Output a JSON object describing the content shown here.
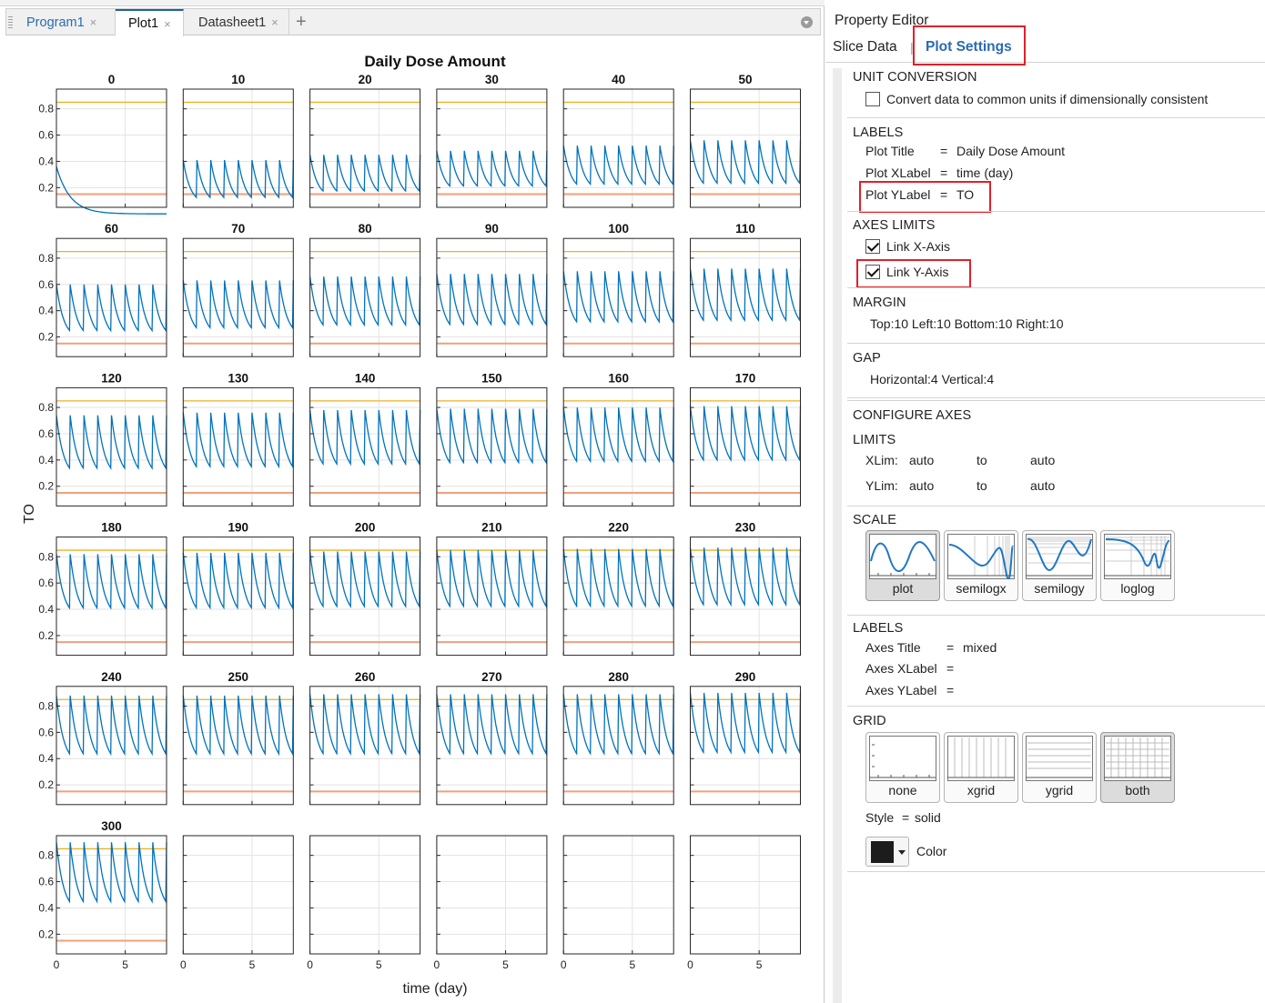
{
  "tabs": [
    {
      "label": "Program1",
      "close": "×"
    },
    {
      "label": "Plot1",
      "close": "×"
    },
    {
      "label": "Datasheet1",
      "close": "×"
    }
  ],
  "tab_add": "+",
  "chart_data": {
    "type": "line",
    "title": "Daily Dose Amount",
    "xlabel": "time (day)",
    "ylabel": "TO",
    "xlim": [
      0,
      8
    ],
    "ylim": [
      0.05,
      0.95
    ],
    "yticks": [
      0.2,
      0.4,
      0.6,
      0.8
    ],
    "xticks": [
      0,
      5
    ],
    "grid": "both",
    "upper_line_y": 0.85,
    "lower_line_y": 0.15,
    "colors": {
      "series": "#0072bd",
      "upper": "#edb120",
      "lower": "#f0a07a"
    },
    "panels": [
      {
        "title": "0",
        "peak": 0.36,
        "trough": 0.0
      },
      {
        "title": "10",
        "peak": 0.41,
        "trough": 0.07
      },
      {
        "title": "20",
        "peak": 0.45,
        "trough": 0.12
      },
      {
        "title": "30",
        "peak": 0.48,
        "trough": 0.16
      },
      {
        "title": "40",
        "peak": 0.52,
        "trough": 0.17
      },
      {
        "title": "50",
        "peak": 0.56,
        "trough": 0.17
      },
      {
        "title": "60",
        "peak": 0.6,
        "trough": 0.18
      },
      {
        "title": "70",
        "peak": 0.63,
        "trough": 0.2
      },
      {
        "title": "80",
        "peak": 0.66,
        "trough": 0.22
      },
      {
        "title": "90",
        "peak": 0.68,
        "trough": 0.22
      },
      {
        "title": "100",
        "peak": 0.7,
        "trough": 0.24
      },
      {
        "title": "110",
        "peak": 0.72,
        "trough": 0.25
      },
      {
        "title": "120",
        "peak": 0.74,
        "trough": 0.26
      },
      {
        "title": "130",
        "peak": 0.76,
        "trough": 0.27
      },
      {
        "title": "140",
        "peak": 0.78,
        "trough": 0.29
      },
      {
        "title": "150",
        "peak": 0.79,
        "trough": 0.3
      },
      {
        "title": "160",
        "peak": 0.8,
        "trough": 0.31
      },
      {
        "title": "170",
        "peak": 0.81,
        "trough": 0.32
      },
      {
        "title": "180",
        "peak": 0.82,
        "trough": 0.33
      },
      {
        "title": "190",
        "peak": 0.83,
        "trough": 0.33
      },
      {
        "title": "200",
        "peak": 0.84,
        "trough": 0.34
      },
      {
        "title": "210",
        "peak": 0.85,
        "trough": 0.34
      },
      {
        "title": "220",
        "peak": 0.86,
        "trough": 0.34
      },
      {
        "title": "230",
        "peak": 0.87,
        "trough": 0.35
      },
      {
        "title": "240",
        "peak": 0.88,
        "trough": 0.35
      },
      {
        "title": "250",
        "peak": 0.88,
        "trough": 0.35
      },
      {
        "title": "260",
        "peak": 0.89,
        "trough": 0.35
      },
      {
        "title": "270",
        "peak": 0.89,
        "trough": 0.35
      },
      {
        "title": "280",
        "peak": 0.89,
        "trough": 0.35
      },
      {
        "title": "290",
        "peak": 0.9,
        "trough": 0.36
      },
      {
        "title": "300",
        "peak": 0.9,
        "trough": 0.36
      }
    ],
    "empty_panels": 5
  },
  "property_editor": {
    "title": "Property Editor",
    "tab_slice": "Slice Data",
    "tab_separator": "|",
    "tab_plot_settings": "Plot Settings",
    "unit_conversion": {
      "heading": "UNIT CONVERSION",
      "checkbox_label": "Convert data to common units if dimensionally consistent",
      "checked": false
    },
    "labels": {
      "heading": "LABELS",
      "plot_title_key": "Plot Title",
      "plot_title_eq": "=",
      "plot_title_value": "Daily Dose Amount",
      "plot_xlabel_key": "Plot XLabel",
      "plot_xlabel_eq": "=",
      "plot_xlabel_value": "time (day)",
      "plot_ylabel_key": "Plot YLabel",
      "plot_ylabel_eq": "=",
      "plot_ylabel_value": "TO"
    },
    "axes_limits": {
      "heading": "AXES LIMITS",
      "link_x": "Link X-Axis",
      "link_y": "Link Y-Axis",
      "link_x_checked": true,
      "link_y_checked": true
    },
    "margin": {
      "heading": "MARGIN",
      "value": "Top:10 Left:10 Bottom:10 Right:10"
    },
    "gap": {
      "heading": "GAP",
      "value": "Horizontal:4 Vertical:4"
    },
    "configure_axes": {
      "heading": "CONFIGURE AXES"
    },
    "limits": {
      "heading": "LIMITS",
      "xlim_key": "XLim:",
      "xlim_from": "auto",
      "xlim_to_word": "to",
      "xlim_to": "auto",
      "ylim_key": "YLim:",
      "ylim_from": "auto",
      "ylim_to_word": "to",
      "ylim_to": "auto"
    },
    "scale": {
      "heading": "SCALE",
      "options": [
        "plot",
        "semilogx",
        "semilogy",
        "loglog"
      ],
      "selected": "plot"
    },
    "axes_labels": {
      "heading": "LABELS",
      "axes_title_key": "Axes Title",
      "axes_title_eq": "=",
      "axes_title_value": "mixed",
      "axes_xlabel_key": "Axes XLabel",
      "axes_xlabel_eq": "=",
      "axes_ylabel_key": "Axes YLabel",
      "axes_ylabel_eq": "="
    },
    "grid": {
      "heading": "GRID",
      "options": [
        "none",
        "xgrid",
        "ygrid",
        "both"
      ],
      "selected": "both",
      "style_key": "Style",
      "style_eq": "=",
      "style_value": "solid",
      "color_label": "Color",
      "color_value": "#1c1c1c"
    }
  },
  "icons": {
    "tab_menu": "chevron-down-icon",
    "color_dropdown": "chevron-down-icon"
  }
}
